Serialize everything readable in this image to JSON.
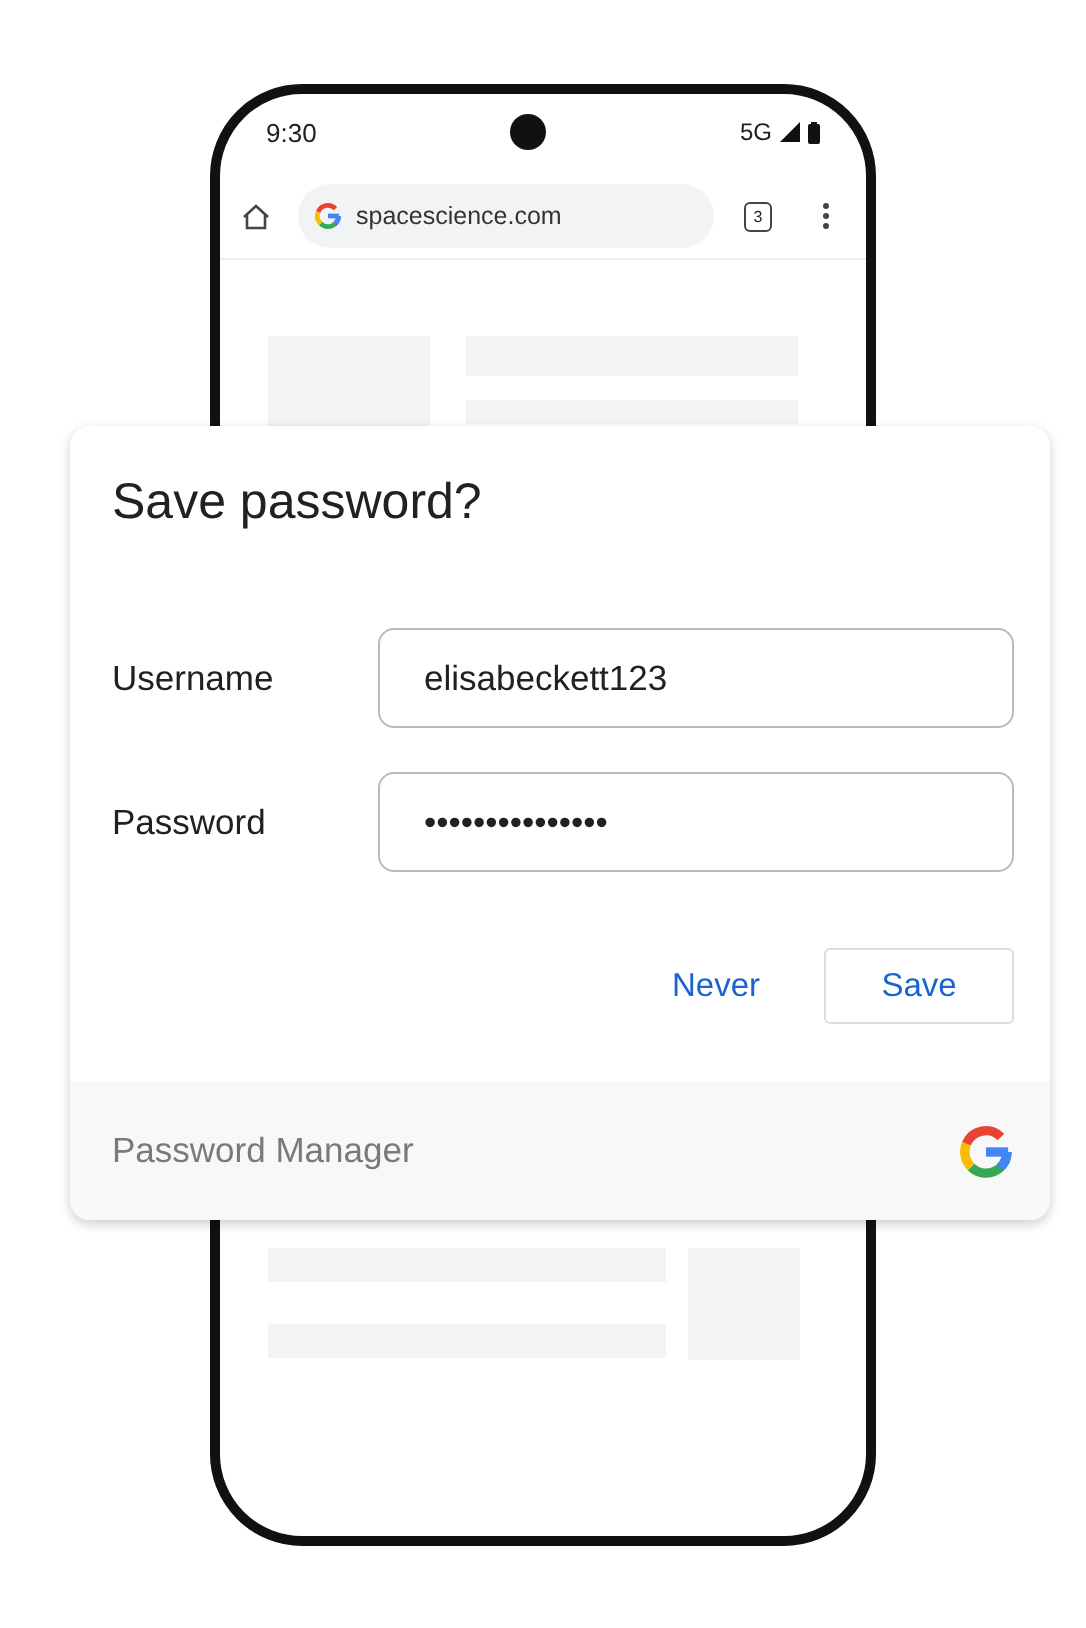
{
  "status_bar": {
    "time": "9:30",
    "network": "5G"
  },
  "browser": {
    "url": "spacescience.com",
    "tab_count": "3"
  },
  "dialog": {
    "title": "Save password?",
    "fields": [
      {
        "label": "Username",
        "value": "elisabeckett123"
      },
      {
        "label": "Password",
        "value": "•••••••••••••••"
      }
    ],
    "buttons": [
      {
        "label": "Never",
        "kind": "text"
      },
      {
        "label": "Save",
        "kind": "outlined"
      }
    ],
    "footer": "Password Manager"
  }
}
